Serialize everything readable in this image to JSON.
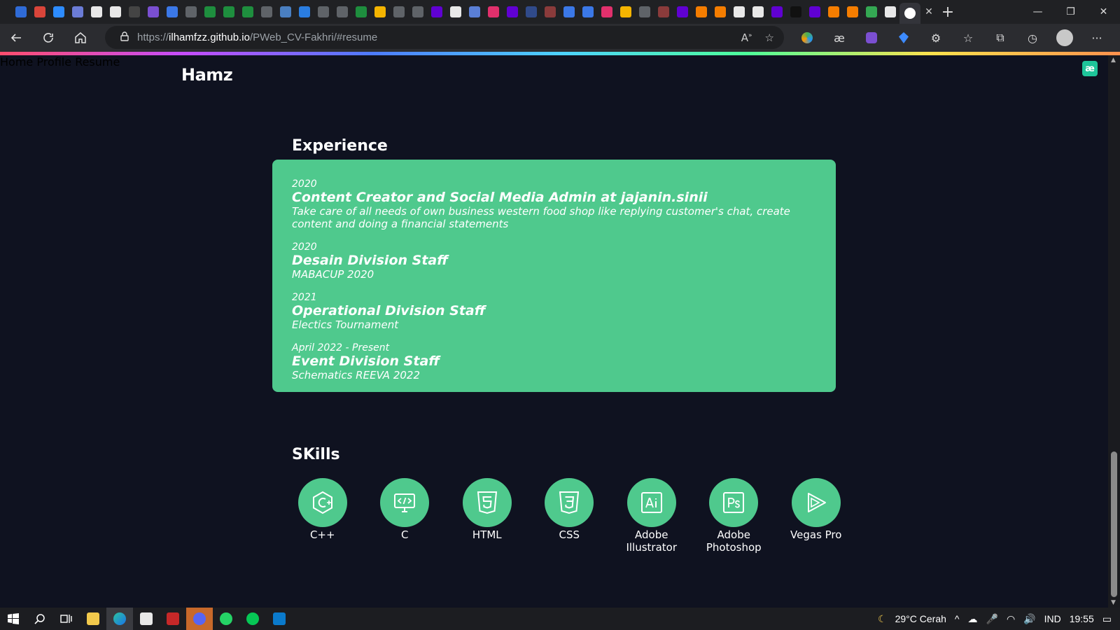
{
  "browser": {
    "tab_colors": [
      "#2f6bd7",
      "#d9453a",
      "#2d8cff",
      "#6b7cd6",
      "#e8e8e8",
      "#e8e8e8",
      "#444",
      "#7a4fd1",
      "#3b78e7",
      "#5f6368",
      "#1e8e3e",
      "#1e8e3e",
      "#1e8e3e",
      "#5f6368",
      "#4a7fc1",
      "#2a7de1",
      "#5f6368",
      "#5f6368",
      "#1e8e3e",
      "#f4b400",
      "#5f6368",
      "#5f6368",
      "#6001d2",
      "#e8e8e8",
      "#5a7fd6",
      "#e1306c",
      "#6001d2",
      "#304a8a",
      "#8a3b3b",
      "#3b78e7",
      "#3b78e7",
      "#e1306c",
      "#f4b400",
      "#5f6368",
      "#8a3b3b",
      "#6001d2",
      "#f57d00",
      "#f57d00",
      "#e8e8e8",
      "#e8e8e8",
      "#6001d2",
      "#111",
      "#6001d2",
      "#f57d00",
      "#f57d00",
      "#34a853",
      "#e8e8e8"
    ],
    "tab_close": "✕",
    "new_tab": "+",
    "window_controls": [
      "—",
      "❐",
      "✕"
    ],
    "url_host": "ilhamfzz.github.io",
    "url_prefix": "https://",
    "url_path": "/PWeb_CV-Fakhri/#resume"
  },
  "site": {
    "brand": "Hamz",
    "nav": [
      "Home",
      "Profile",
      "Resume"
    ],
    "ext_badge": "æ"
  },
  "experience": {
    "title": "Experience",
    "items": [
      {
        "year": "2020",
        "role": "Content Creator and Social Media Admin at jajanin.sinii",
        "desc": "Take care of all needs of own business western food shop like replying customer's chat, create content and doing a financial statements"
      },
      {
        "year": "2020",
        "role": "Desain Division Staff",
        "desc": "MABACUP 2020"
      },
      {
        "year": "2021",
        "role": "Operational Division Staff",
        "desc": "Electics Tournament"
      },
      {
        "year": "April 2022 - Present",
        "role": "Event Division Staff",
        "desc": "Schematics REEVA 2022"
      }
    ]
  },
  "skills": {
    "title": "SKills",
    "items": [
      {
        "label": "C++",
        "icon": "cpp-icon"
      },
      {
        "label": "C",
        "icon": "code-monitor-icon"
      },
      {
        "label": "HTML",
        "icon": "html5-icon"
      },
      {
        "label": "CSS",
        "icon": "css3-icon"
      },
      {
        "label": "Adobe Illustrator",
        "icon": "illustrator-icon"
      },
      {
        "label": "Adobe Photoshop",
        "icon": "photoshop-icon"
      },
      {
        "label": "Vegas Pro",
        "icon": "vegas-icon"
      }
    ]
  },
  "taskbar": {
    "weather": "29°C Cerah",
    "lang": "IND",
    "time": "19:55"
  }
}
